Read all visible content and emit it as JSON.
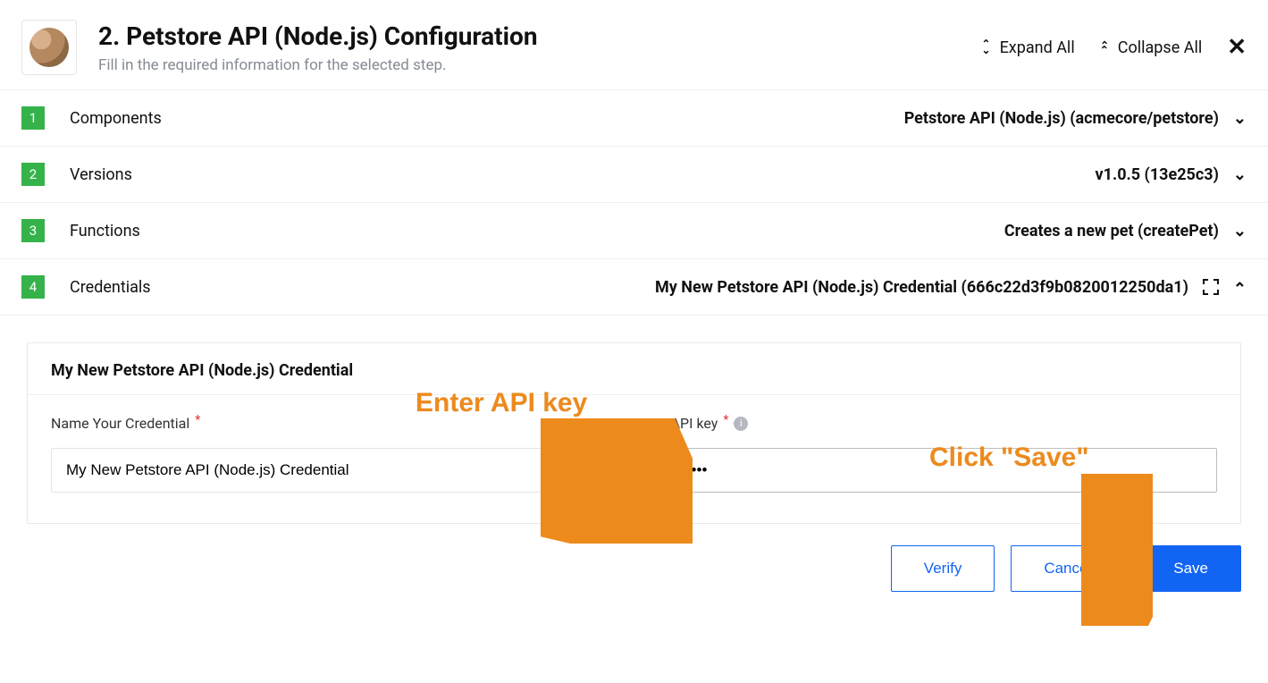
{
  "header": {
    "title": "2. Petstore API (Node.js) Configuration",
    "subtitle": "Fill in the required information for the selected step.",
    "expand_label": "Expand All",
    "collapse_label": "Collapse All"
  },
  "rows": [
    {
      "num": "1",
      "label": "Components",
      "value": "Petstore API (Node.js) (acmecore/petstore)"
    },
    {
      "num": "2",
      "label": "Versions",
      "value": "v1.0.5 (13e25c3)"
    },
    {
      "num": "3",
      "label": "Functions",
      "value": "Creates a new pet (createPet)"
    },
    {
      "num": "4",
      "label": "Credentials",
      "value": "My New Petstore API (Node.js) Credential (666c22d3f9b0820012250da1)"
    }
  ],
  "panel": {
    "title": "My New Petstore API (Node.js) Credential",
    "name_label": "Name Your Credential",
    "name_value": "My New Petstore API (Node.js) Credential",
    "apikey_label": "API key",
    "apikey_value": "••••"
  },
  "actions": {
    "verify": "Verify",
    "cancel": "Cancel",
    "save": "Save"
  },
  "annotations": {
    "enter_api_key": "Enter API key",
    "click_save": "Click \"Save\""
  }
}
